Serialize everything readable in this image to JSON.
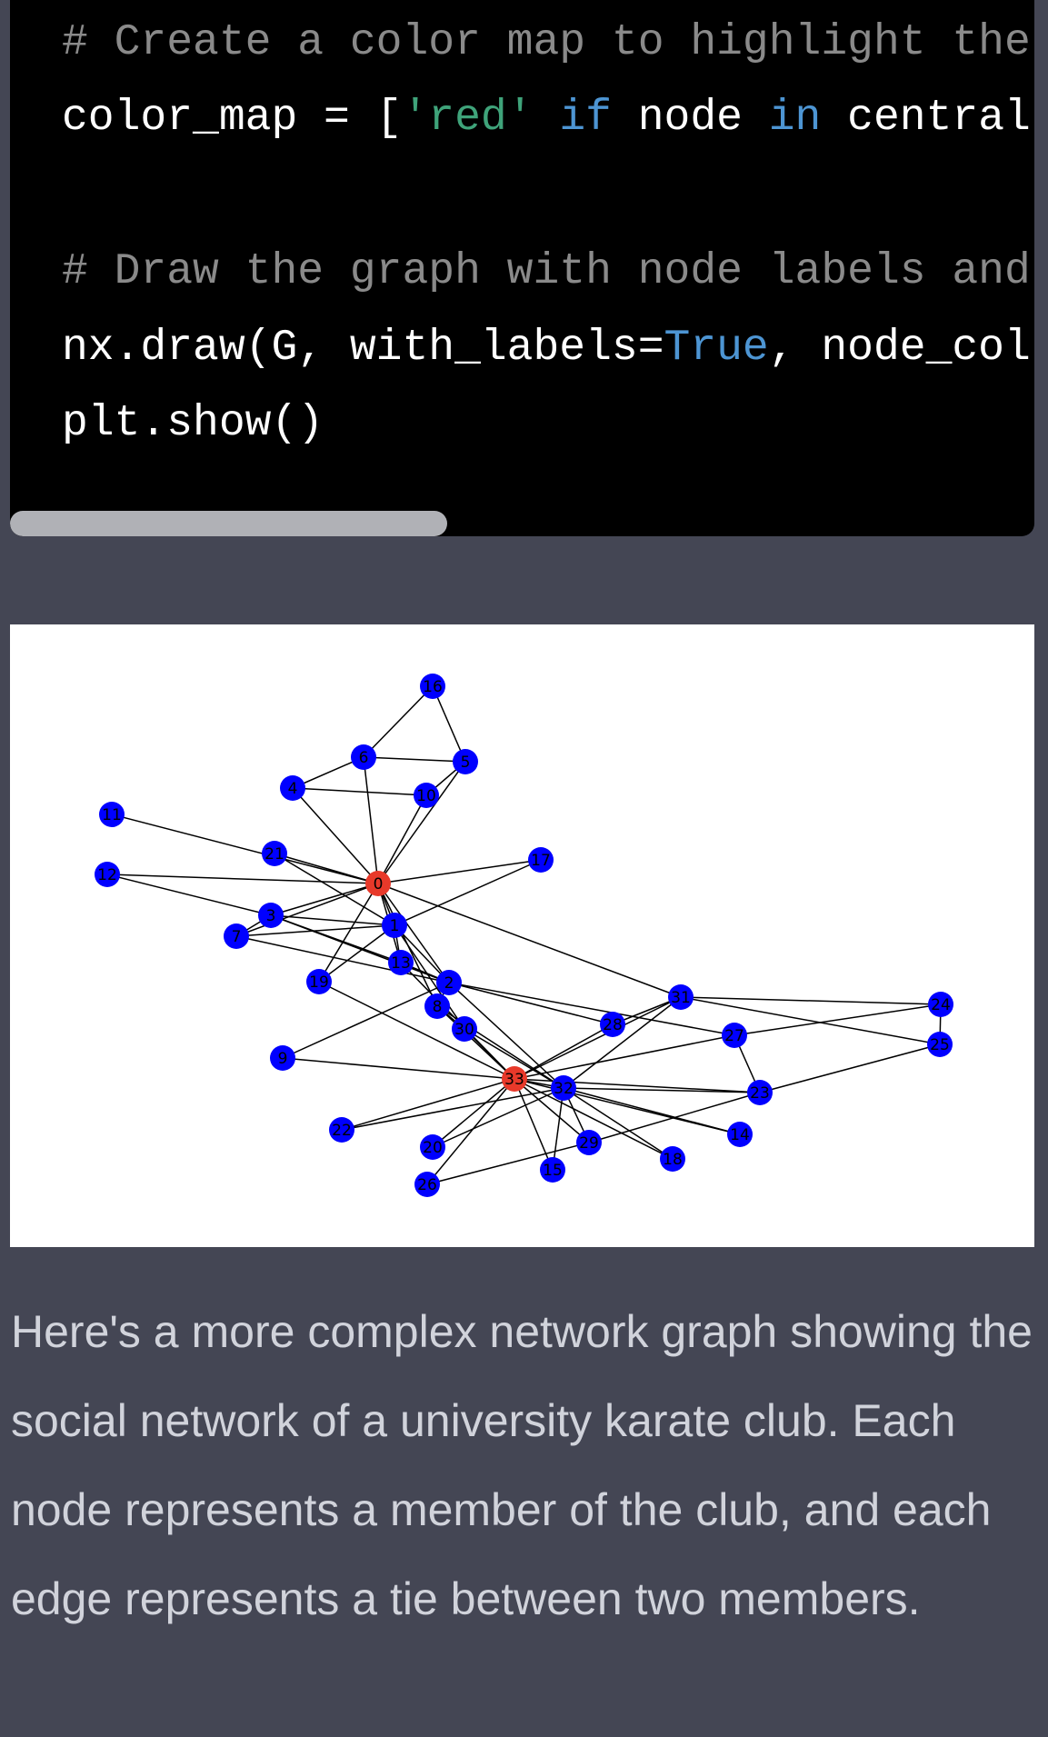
{
  "code": {
    "lines": [
      [
        {
          "t": "# Create a color map to highlight the",
          "c": "comment"
        }
      ],
      [
        {
          "t": "color_map = [",
          "c": "plain"
        },
        {
          "t": "'red'",
          "c": "string"
        },
        {
          "t": " ",
          "c": "plain"
        },
        {
          "t": "if",
          "c": "keyword"
        },
        {
          "t": " node ",
          "c": "plain"
        },
        {
          "t": "in",
          "c": "keyword"
        },
        {
          "t": " central",
          "c": "plain"
        }
      ],
      [],
      [
        {
          "t": "# Draw the graph with node labels and",
          "c": "comment"
        }
      ],
      [
        {
          "t": "nx.draw(G, with_labels=",
          "c": "plain"
        },
        {
          "t": "True",
          "c": "keyword"
        },
        {
          "t": ", node_col",
          "c": "plain"
        }
      ],
      [
        {
          "t": "plt.show()",
          "c": "plain"
        }
      ]
    ]
  },
  "chart_data": {
    "type": "network",
    "node_colors": {
      "default": "#0000ff",
      "highlight": "#e8392a"
    },
    "edge_color": "#000000",
    "highlighted_nodes": [
      0,
      33
    ],
    "nodes": [
      0,
      1,
      2,
      3,
      4,
      5,
      6,
      7,
      8,
      9,
      10,
      11,
      12,
      13,
      14,
      15,
      16,
      17,
      18,
      19,
      20,
      21,
      22,
      23,
      24,
      25,
      26,
      27,
      28,
      29,
      30,
      31,
      32,
      33
    ],
    "edges": [
      [
        0,
        1
      ],
      [
        0,
        2
      ],
      [
        0,
        3
      ],
      [
        0,
        4
      ],
      [
        0,
        5
      ],
      [
        0,
        6
      ],
      [
        0,
        7
      ],
      [
        0,
        8
      ],
      [
        0,
        10
      ],
      [
        0,
        11
      ],
      [
        0,
        12
      ],
      [
        0,
        13
      ],
      [
        0,
        17
      ],
      [
        0,
        19
      ],
      [
        0,
        21
      ],
      [
        0,
        31
      ],
      [
        1,
        2
      ],
      [
        1,
        3
      ],
      [
        1,
        7
      ],
      [
        1,
        13
      ],
      [
        1,
        17
      ],
      [
        1,
        19
      ],
      [
        1,
        21
      ],
      [
        1,
        30
      ],
      [
        2,
        3
      ],
      [
        2,
        7
      ],
      [
        2,
        8
      ],
      [
        2,
        9
      ],
      [
        2,
        13
      ],
      [
        2,
        27
      ],
      [
        2,
        28
      ],
      [
        2,
        32
      ],
      [
        3,
        7
      ],
      [
        3,
        12
      ],
      [
        3,
        13
      ],
      [
        4,
        6
      ],
      [
        4,
        10
      ],
      [
        5,
        6
      ],
      [
        5,
        10
      ],
      [
        5,
        16
      ],
      [
        6,
        16
      ],
      [
        8,
        30
      ],
      [
        8,
        32
      ],
      [
        8,
        33
      ],
      [
        9,
        33
      ],
      [
        13,
        33
      ],
      [
        14,
        32
      ],
      [
        14,
        33
      ],
      [
        15,
        32
      ],
      [
        15,
        33
      ],
      [
        18,
        32
      ],
      [
        18,
        33
      ],
      [
        19,
        33
      ],
      [
        20,
        32
      ],
      [
        20,
        33
      ],
      [
        22,
        32
      ],
      [
        22,
        33
      ],
      [
        23,
        25
      ],
      [
        23,
        27
      ],
      [
        23,
        29
      ],
      [
        23,
        32
      ],
      [
        23,
        33
      ],
      [
        24,
        25
      ],
      [
        24,
        27
      ],
      [
        24,
        31
      ],
      [
        25,
        31
      ],
      [
        26,
        29
      ],
      [
        26,
        33
      ],
      [
        27,
        33
      ],
      [
        28,
        31
      ],
      [
        28,
        33
      ],
      [
        29,
        32
      ],
      [
        29,
        33
      ],
      [
        30,
        32
      ],
      [
        30,
        33
      ],
      [
        31,
        32
      ],
      [
        31,
        33
      ],
      [
        32,
        33
      ]
    ]
  },
  "message": {
    "text": "Here's a more complex network graph showing the social network of a university karate club. Each node represents a member of the club, and each edge represents a tie between two members."
  }
}
